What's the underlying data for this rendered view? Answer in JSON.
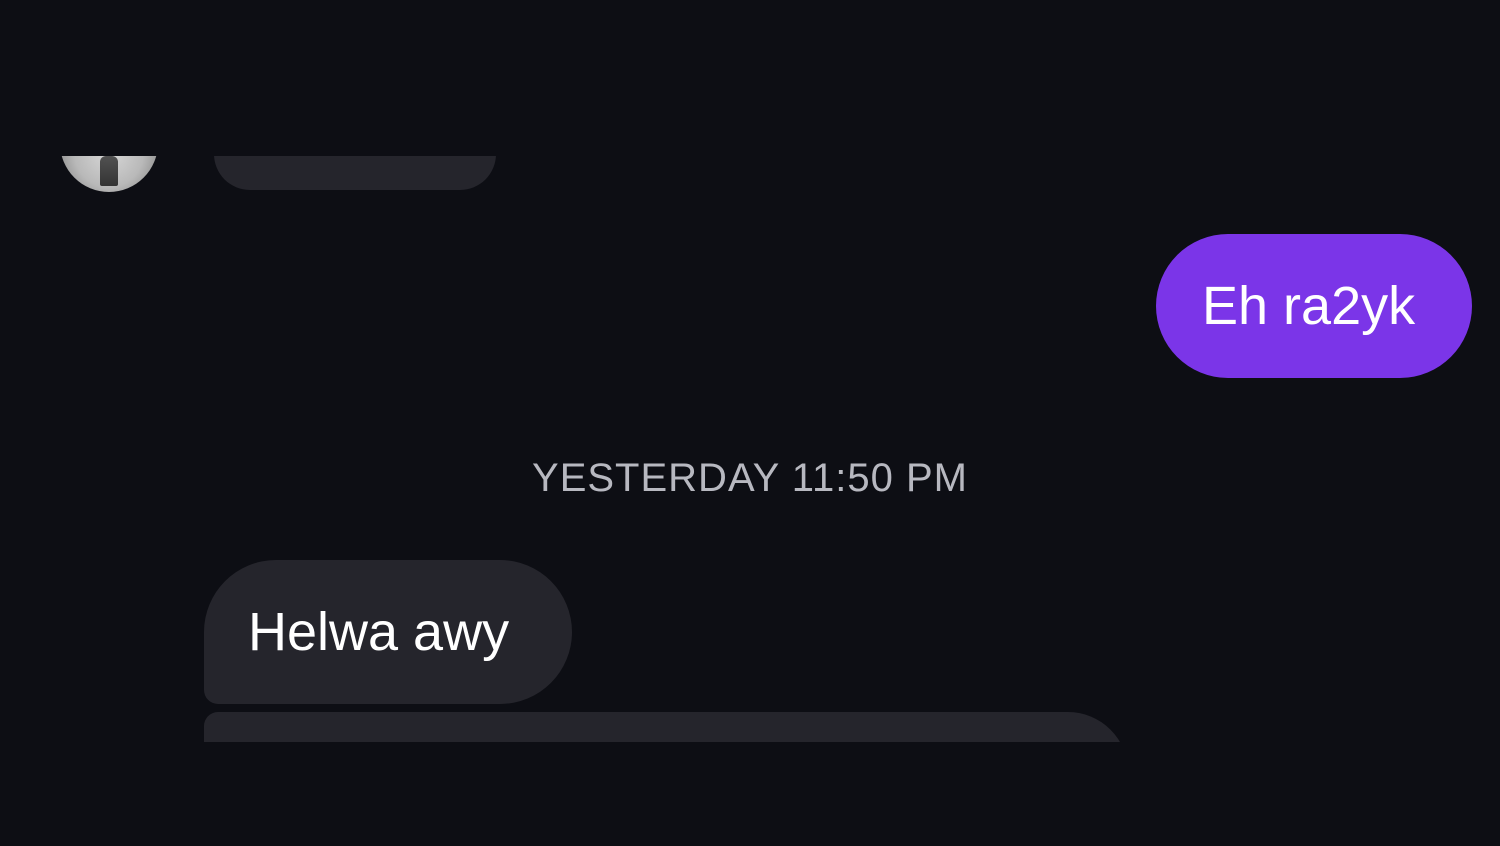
{
  "conversation": {
    "messages": [
      {
        "sender": "me",
        "text": "Eh ra2yk"
      },
      {
        "sender": "them",
        "text": "Helwa awy"
      }
    ],
    "timestamp": "YESTERDAY 11:50 PM"
  },
  "colors": {
    "background": "#0d0e14",
    "sent_bubble": "#7b35e8",
    "received_bubble": "#25252c",
    "timestamp_text": "#b7b8c0"
  }
}
